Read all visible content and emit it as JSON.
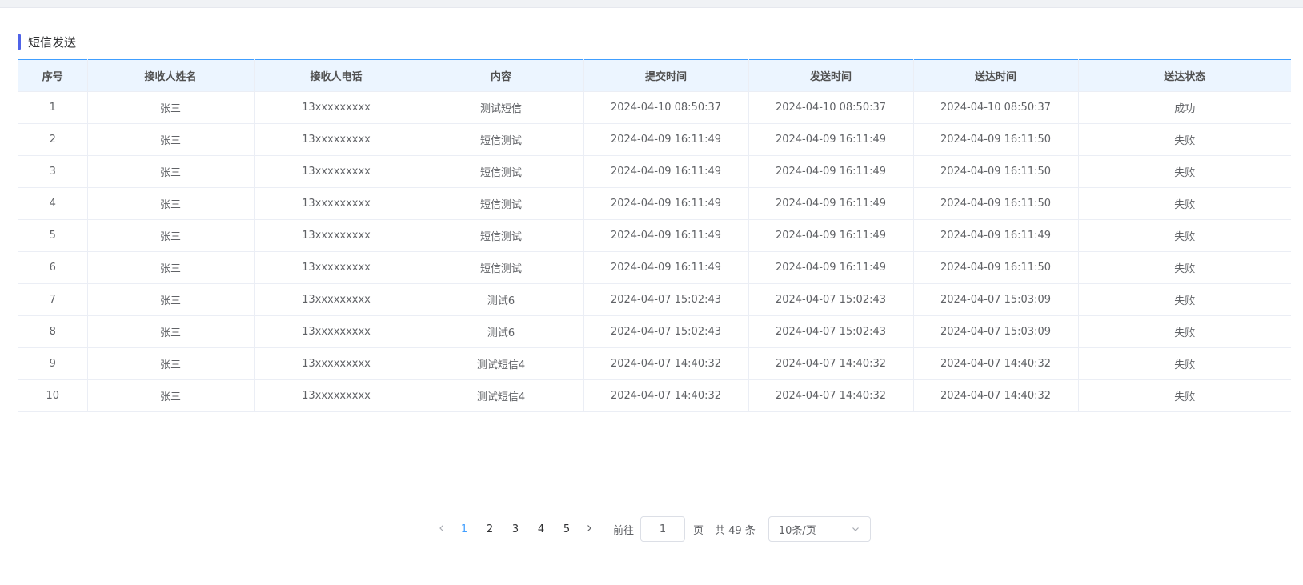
{
  "section": {
    "title": "短信发送"
  },
  "table": {
    "columns": [
      "序号",
      "接收人姓名",
      "接收人电话",
      "内容",
      "提交时间",
      "发送时间",
      "送达时间",
      "送达状态"
    ],
    "rows": [
      [
        "1",
        "张三",
        "13xxxxxxxxx",
        "测试短信",
        "2024-04-10 08:50:37",
        "2024-04-10 08:50:37",
        "2024-04-10 08:50:37",
        "成功"
      ],
      [
        "2",
        "张三",
        "13xxxxxxxxx",
        "短信测试",
        "2024-04-09 16:11:49",
        "2024-04-09 16:11:49",
        "2024-04-09 16:11:50",
        "失败"
      ],
      [
        "3",
        "张三",
        "13xxxxxxxxx",
        "短信测试",
        "2024-04-09 16:11:49",
        "2024-04-09 16:11:49",
        "2024-04-09 16:11:50",
        "失败"
      ],
      [
        "4",
        "张三",
        "13xxxxxxxxx",
        "短信测试",
        "2024-04-09 16:11:49",
        "2024-04-09 16:11:49",
        "2024-04-09 16:11:50",
        "失败"
      ],
      [
        "5",
        "张三",
        "13xxxxxxxxx",
        "短信测试",
        "2024-04-09 16:11:49",
        "2024-04-09 16:11:49",
        "2024-04-09 16:11:49",
        "失败"
      ],
      [
        "6",
        "张三",
        "13xxxxxxxxx",
        "短信测试",
        "2024-04-09 16:11:49",
        "2024-04-09 16:11:49",
        "2024-04-09 16:11:50",
        "失败"
      ],
      [
        "7",
        "张三",
        "13xxxxxxxxx",
        "测试6",
        "2024-04-07 15:02:43",
        "2024-04-07 15:02:43",
        "2024-04-07 15:03:09",
        "失败"
      ],
      [
        "8",
        "张三",
        "13xxxxxxxxx",
        "测试6",
        "2024-04-07 15:02:43",
        "2024-04-07 15:02:43",
        "2024-04-07 15:03:09",
        "失败"
      ],
      [
        "9",
        "张三",
        "13xxxxxxxxx",
        "测试短信4",
        "2024-04-07 14:40:32",
        "2024-04-07 14:40:32",
        "2024-04-07 14:40:32",
        "失败"
      ],
      [
        "10",
        "张三",
        "13xxxxxxxxx",
        "测试短信4",
        "2024-04-07 14:40:32",
        "2024-04-07 14:40:32",
        "2024-04-07 14:40:32",
        "失败"
      ]
    ]
  },
  "pagination": {
    "prev_icon": "chevron-left-icon",
    "next_icon": "chevron-right-icon",
    "pages": [
      "1",
      "2",
      "3",
      "4",
      "5"
    ],
    "current_page": "1",
    "goto_label": "前往",
    "goto_value": "1",
    "page_suffix": "页",
    "total_text": "共 49 条",
    "page_size": "10条/页",
    "dropdown_icon": "chevron-down-icon"
  },
  "colors": {
    "accent": "#409eff",
    "title_bar": "#4f63e8",
    "header_bg": "#ecf5ff"
  }
}
